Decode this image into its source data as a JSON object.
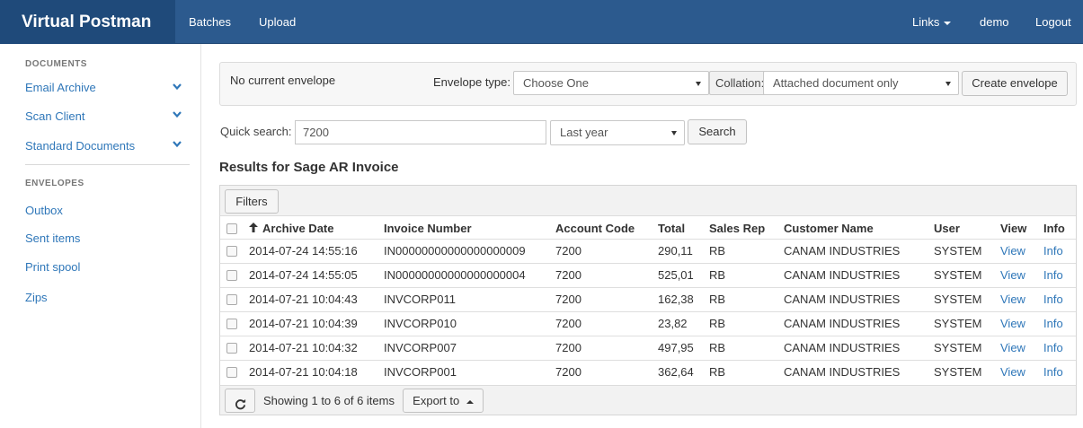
{
  "navbar": {
    "brand": "Virtual Postman",
    "links": [
      "Batches",
      "Upload"
    ],
    "right_links_label": "Links",
    "user": "demo",
    "logout": "Logout"
  },
  "sidebar": {
    "documents_heading": "DOCUMENTS",
    "document_items": [
      "Email Archive",
      "Scan Client",
      "Standard Documents"
    ],
    "envelopes_heading": "ENVELOPES",
    "envelope_items": [
      "Outbox",
      "Sent items",
      "Print spool",
      "Zips"
    ]
  },
  "envelope": {
    "status": "No current envelope",
    "type_label": "Envelope type:",
    "type_value": "Choose One",
    "collation_label": "Collation:",
    "collation_value": "Attached document only",
    "create_button": "Create envelope"
  },
  "search": {
    "label": "Quick search:",
    "value": "7200",
    "period": "Last year",
    "button": "Search"
  },
  "results": {
    "title": "Results for Sage AR Invoice",
    "filters_button": "Filters",
    "columns": [
      "Archive Date",
      "Invoice Number",
      "Account Code",
      "Total",
      "Sales Rep",
      "Customer Name",
      "User",
      "View",
      "Info"
    ],
    "rows": [
      [
        "2014-07-24 14:55:16",
        "IN00000000000000000009",
        "7200",
        "290,11",
        "RB",
        "CANAM INDUSTRIES",
        "SYSTEM",
        "View",
        "Info"
      ],
      [
        "2014-07-24 14:55:05",
        "IN00000000000000000004",
        "7200",
        "525,01",
        "RB",
        "CANAM INDUSTRIES",
        "SYSTEM",
        "View",
        "Info"
      ],
      [
        "2014-07-21 10:04:43",
        "INVCORP011",
        "7200",
        "162,38",
        "RB",
        "CANAM INDUSTRIES",
        "SYSTEM",
        "View",
        "Info"
      ],
      [
        "2014-07-21 10:04:39",
        "INVCORP010",
        "7200",
        "23,82",
        "RB",
        "CANAM INDUSTRIES",
        "SYSTEM",
        "View",
        "Info"
      ],
      [
        "2014-07-21 10:04:32",
        "INVCORP007",
        "7200",
        "497,95",
        "RB",
        "CANAM INDUSTRIES",
        "SYSTEM",
        "View",
        "Info"
      ],
      [
        "2014-07-21 10:04:18",
        "INVCORP001",
        "7200",
        "362,64",
        "RB",
        "CANAM INDUSTRIES",
        "SYSTEM",
        "View",
        "Info"
      ]
    ],
    "paging_text": "Showing 1 to 6 of 6 items",
    "export_button": "Export to"
  },
  "colors": {
    "navbar": "#2c5a8e",
    "brand": "#1f4a7a",
    "link": "#2f77b9"
  },
  "icons": {
    "sort": "arrow-up-icon",
    "refresh": "refresh-icon",
    "chevron": "chevron-down-icon",
    "dropdown": "caret-down-icon"
  }
}
